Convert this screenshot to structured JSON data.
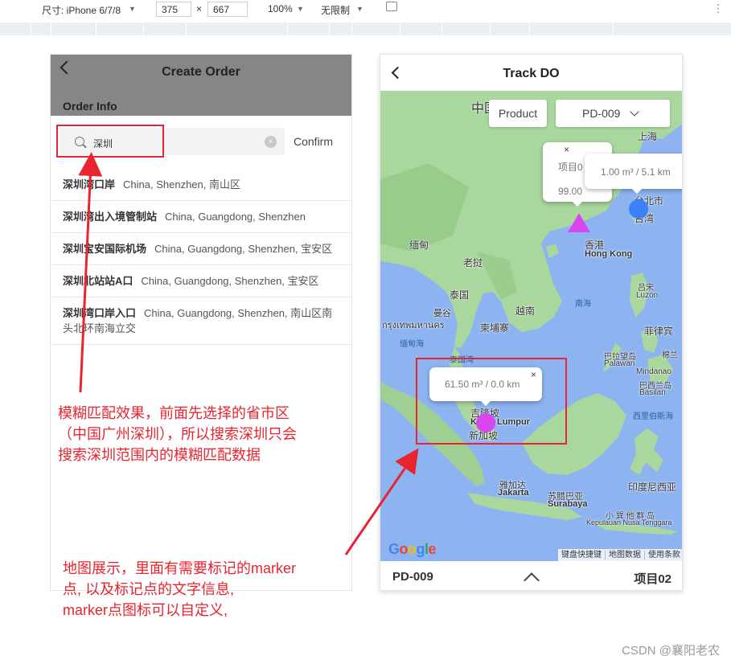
{
  "devtools": {
    "size_label": "尺寸: iPhone 6/7/8",
    "width": "375",
    "times": "×",
    "height": "667",
    "zoom": "100%",
    "throttle": "无限制",
    "more": "⋮"
  },
  "left_screen": {
    "title": "Create Order",
    "section": "Order Info",
    "search": {
      "value": "深圳",
      "clear": "×",
      "confirm": "Confirm"
    },
    "results": [
      {
        "name": "深圳湾口岸",
        "detail": "China, Shenzhen, 南山区"
      },
      {
        "name": "深圳湾出入境管制站",
        "detail": "China, Guangdong, Shenzhen"
      },
      {
        "name": "深圳宝安国际机场",
        "detail": "China, Guangdong, Shenzhen, 宝安区"
      },
      {
        "name": "深圳北站站A口",
        "detail": "China, Guangdong, Shenzhen, 宝安区"
      },
      {
        "name": "深圳湾口岸入口",
        "detail": "China, Guangdong, Shenzhen, 南山区南头北环南海立交"
      }
    ]
  },
  "right_screen": {
    "title": "Track DO",
    "product_label": "Product",
    "product_value": "PD-009",
    "popups": [
      {
        "line1": "项目0",
        "line2": "99.00"
      },
      {
        "line1": "1.00 m³ / 5.1 km"
      },
      {
        "line1": "61.50 m³ / 0.0 km"
      }
    ],
    "popup_close": "×",
    "map_labels": {
      "china": "中国",
      "shanghai": "上海",
      "taipei": "台北市",
      "taiwan": "台湾",
      "hongkong_cn": "香港",
      "hongkong_en": "Hong Kong",
      "myanmar": "缅甸",
      "laos": "老挝",
      "thailand": "泰国",
      "bangkok_cn": "曼谷",
      "bangkok_th": "กรุงเทพมหานคร",
      "vietnam": "越南",
      "cambodia": "柬埔寨",
      "south_china_sea": "南海",
      "andaman": "缅甸海",
      "gulf_thailand": "泰国湾",
      "philippines": "菲律宾",
      "luzon_cn": "吕宋",
      "luzon_en": "Luzon",
      "mindanao_cn": "棉兰",
      "mindanao_en": "Mindanao",
      "palawan_cn": "巴拉望岛",
      "palawan_en": "Palawan",
      "basilan_cn": "巴西兰岛",
      "basilan_en": "Basilan",
      "celebes": "西里伯斯海",
      "kl": "吉隆坡",
      "kl_en": "Kuala Lumpur",
      "singapore": "新加坡",
      "jakarta_cn": "雅加达",
      "jakarta_en": "Jakarta",
      "surabaya_cn": "苏腊巴亚",
      "surabaya_en": "Surabaya",
      "indonesia": "印度尼西亚",
      "lesser_sunda_cn": "小 巽 他 群 岛",
      "lesser_sunda_en": "Kepulauan Nusa Tenggara"
    },
    "google": [
      "G",
      "o",
      "o",
      "g",
      "l",
      "e"
    ],
    "attribution": [
      "键盘快捷键",
      "地图数据",
      "使用条款"
    ],
    "footer": {
      "left": "PD-009",
      "right": "项目02"
    }
  },
  "annotations": {
    "search_note": [
      "模糊匹配效果，前面先选择的省市区",
      "（中国广州深圳），所以搜索深圳只会",
      "搜索深圳范围内的模糊匹配数据"
    ],
    "map_note": [
      "地图展示，里面有需要标记的marker",
      "点, 以及标记点的文字信息,",
      "marker点图标可以自定义,"
    ]
  },
  "watermark": "CSDN @襄阳老农",
  "colors": {
    "highlight": "#e8242f",
    "marker_violet": "#d946ef",
    "marker_blue": "#3b82f6",
    "sea": "#8db4f1",
    "land": "#a9d79e"
  }
}
